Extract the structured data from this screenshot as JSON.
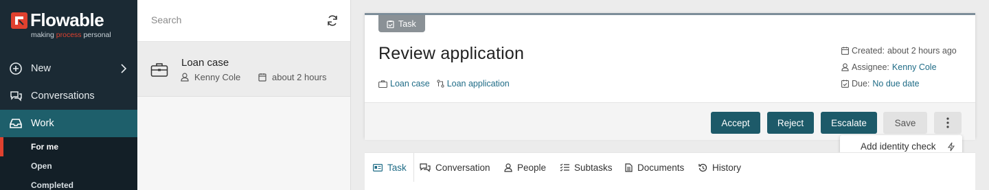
{
  "brand": {
    "name": "Flowable",
    "tagline_pre": "making ",
    "tagline_accent": "process",
    "tagline_post": " personal",
    "accent_color": "#e0412f"
  },
  "sidebar": {
    "items": [
      {
        "label": "New",
        "icon": "plus-circle-icon"
      },
      {
        "label": "Conversations",
        "icon": "chat-icon"
      },
      {
        "label": "Work",
        "icon": "inbox-icon"
      }
    ],
    "subitems": [
      {
        "label": "For me"
      },
      {
        "label": "Open"
      },
      {
        "label": "Completed"
      }
    ]
  },
  "list": {
    "search_placeholder": "Search",
    "cases": [
      {
        "title": "Loan case",
        "assignee": "Kenny Cole",
        "time": "about 2 hours"
      }
    ]
  },
  "task": {
    "chip_label": "Task",
    "title": "Review application",
    "links": [
      {
        "label": "Loan case"
      },
      {
        "label": "Loan application"
      }
    ],
    "meta": {
      "created_label": "Created:",
      "created_value": "about 2 hours ago",
      "assignee_label": "Assignee:",
      "assignee_value": "Kenny Cole",
      "due_label": "Due:",
      "due_value": "No due date"
    },
    "actions": {
      "accept": "Accept",
      "reject": "Reject",
      "escalate": "Escalate",
      "save": "Save"
    },
    "menu": {
      "add_identity_check": "Add identity check"
    }
  },
  "tabs": [
    {
      "label": "Task"
    },
    {
      "label": "Conversation"
    },
    {
      "label": "People"
    },
    {
      "label": "Subtasks"
    },
    {
      "label": "Documents"
    },
    {
      "label": "History"
    }
  ]
}
